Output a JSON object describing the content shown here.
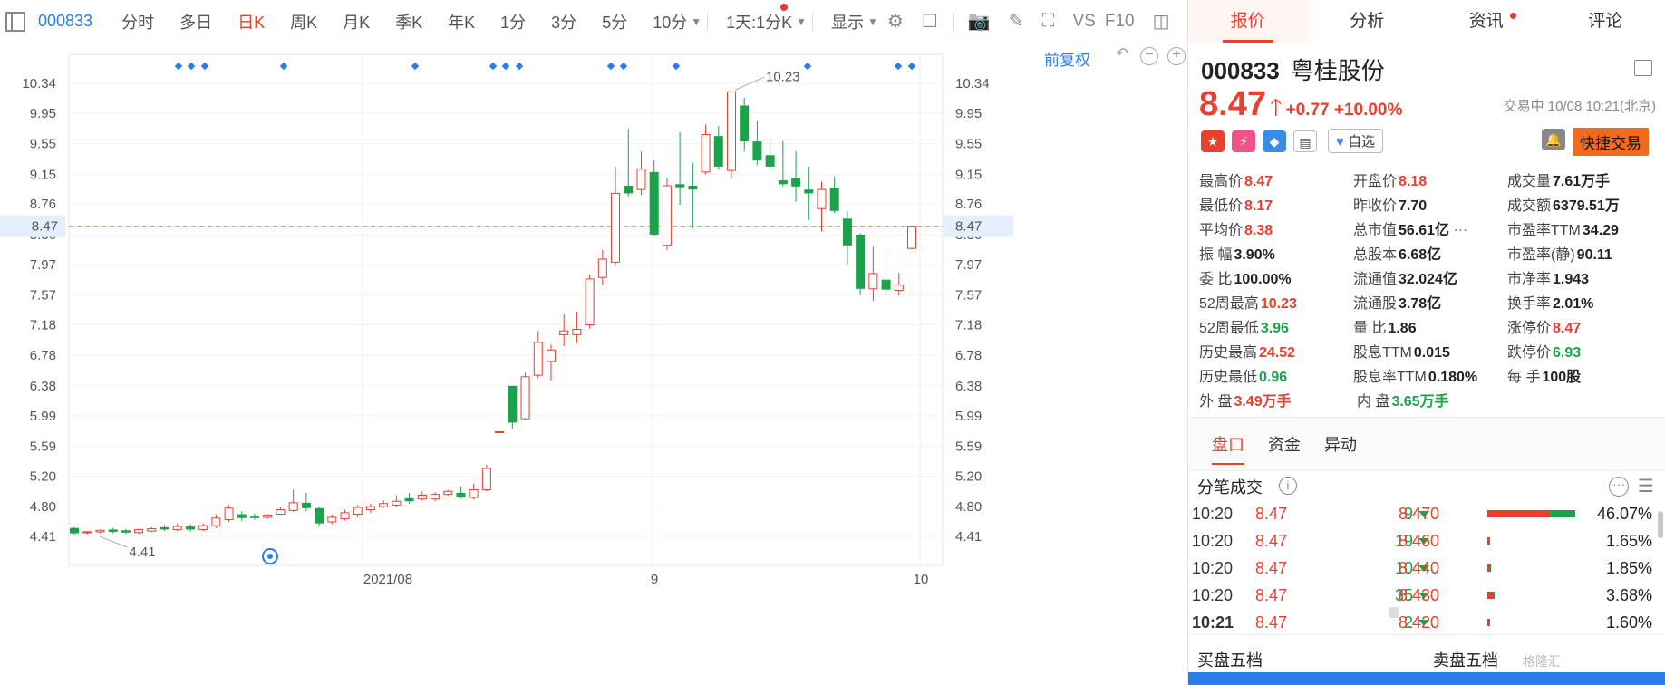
{
  "toolbar": {
    "code": "000833",
    "periods": [
      "分时",
      "多日",
      "日K",
      "周K",
      "月K",
      "季K",
      "年K",
      "1分",
      "3分",
      "5分",
      "10分"
    ],
    "active_period": "日K",
    "range_select": "1天:1分K",
    "display_label": "显示",
    "vs_label": "VS",
    "f10_label": "F10"
  },
  "chart_header": {
    "fuquan": "前复权"
  },
  "chart_data": {
    "type": "candlestick",
    "y_ticks": [
      "10.34",
      "9.95",
      "9.55",
      "9.15",
      "8.76",
      "8.36",
      "7.97",
      "7.57",
      "7.18",
      "6.78",
      "6.38",
      "5.99",
      "5.59",
      "5.20",
      "4.80",
      "4.41"
    ],
    "ylim": [
      4.41,
      10.34
    ],
    "x_labels": [
      "2021/08",
      "9",
      "10"
    ],
    "current_price_label": "8.47",
    "high_annotation": "10.23",
    "low_annotation": "4.41",
    "up_color": "#e8402f",
    "down_color": "#1aa34a",
    "candles": [
      {
        "o": 4.52,
        "c": 4.45,
        "h": 4.53,
        "l": 4.43
      },
      {
        "o": 4.46,
        "c": 4.47,
        "h": 4.48,
        "l": 4.43
      },
      {
        "o": 4.47,
        "c": 4.49,
        "h": 4.5,
        "l": 4.45
      },
      {
        "o": 4.5,
        "c": 4.47,
        "h": 4.52,
        "l": 4.45
      },
      {
        "o": 4.49,
        "c": 4.46,
        "h": 4.51,
        "l": 4.44
      },
      {
        "o": 4.46,
        "c": 4.5,
        "h": 4.51,
        "l": 4.44
      },
      {
        "o": 4.48,
        "c": 4.51,
        "h": 4.53,
        "l": 4.47
      },
      {
        "o": 4.53,
        "c": 4.5,
        "h": 4.56,
        "l": 4.48
      },
      {
        "o": 4.5,
        "c": 4.54,
        "h": 4.58,
        "l": 4.48
      },
      {
        "o": 4.54,
        "c": 4.5,
        "h": 4.57,
        "l": 4.47
      },
      {
        "o": 4.5,
        "c": 4.55,
        "h": 4.58,
        "l": 4.48
      },
      {
        "o": 4.55,
        "c": 4.65,
        "h": 4.7,
        "l": 4.52
      },
      {
        "o": 4.63,
        "c": 4.78,
        "h": 4.82,
        "l": 4.6
      },
      {
        "o": 4.7,
        "c": 4.65,
        "h": 4.74,
        "l": 4.61
      },
      {
        "o": 4.67,
        "c": 4.65,
        "h": 4.71,
        "l": 4.63
      },
      {
        "o": 4.66,
        "c": 4.69,
        "h": 4.7,
        "l": 4.64
      },
      {
        "o": 4.7,
        "c": 4.76,
        "h": 4.79,
        "l": 4.69
      },
      {
        "o": 4.75,
        "c": 4.85,
        "h": 5.02,
        "l": 4.73
      },
      {
        "o": 4.85,
        "c": 4.78,
        "h": 4.98,
        "l": 4.74
      },
      {
        "o": 4.78,
        "c": 4.58,
        "h": 4.8,
        "l": 4.55
      },
      {
        "o": 4.6,
        "c": 4.66,
        "h": 4.7,
        "l": 4.57
      },
      {
        "o": 4.64,
        "c": 4.72,
        "h": 4.76,
        "l": 4.62
      },
      {
        "o": 4.7,
        "c": 4.79,
        "h": 4.82,
        "l": 4.66
      },
      {
        "o": 4.76,
        "c": 4.8,
        "h": 4.84,
        "l": 4.72
      },
      {
        "o": 4.8,
        "c": 4.84,
        "h": 4.88,
        "l": 4.78
      },
      {
        "o": 4.82,
        "c": 4.87,
        "h": 4.95,
        "l": 4.8
      },
      {
        "o": 4.91,
        "c": 4.87,
        "h": 4.98,
        "l": 4.84
      },
      {
        "o": 4.9,
        "c": 4.95,
        "h": 5.0,
        "l": 4.88
      },
      {
        "o": 4.9,
        "c": 4.96,
        "h": 4.99,
        "l": 4.87
      },
      {
        "o": 4.96,
        "c": 5.0,
        "h": 5.02,
        "l": 4.94
      },
      {
        "o": 4.98,
        "c": 4.92,
        "h": 5.06,
        "l": 4.9
      },
      {
        "o": 4.92,
        "c": 5.02,
        "h": 5.1,
        "l": 4.89
      },
      {
        "o": 5.02,
        "c": 5.3,
        "h": 5.35,
        "l": 5.0
      },
      {
        "o": 5.78,
        "c": 5.78,
        "h": 5.78,
        "l": 5.78
      },
      {
        "o": 6.38,
        "c": 5.9,
        "h": 6.38,
        "l": 5.82
      },
      {
        "o": 5.95,
        "c": 6.5,
        "h": 6.55,
        "l": 5.93
      },
      {
        "o": 6.52,
        "c": 6.95,
        "h": 7.1,
        "l": 6.48
      },
      {
        "o": 6.7,
        "c": 6.85,
        "h": 6.92,
        "l": 6.45
      },
      {
        "o": 7.05,
        "c": 7.1,
        "h": 7.32,
        "l": 6.9
      },
      {
        "o": 7.05,
        "c": 7.12,
        "h": 7.35,
        "l": 6.94
      },
      {
        "o": 7.18,
        "c": 7.78,
        "h": 7.83,
        "l": 7.13
      },
      {
        "o": 7.8,
        "c": 8.04,
        "h": 8.16,
        "l": 7.7
      },
      {
        "o": 8.0,
        "c": 8.9,
        "h": 9.25,
        "l": 7.95
      },
      {
        "o": 9.0,
        "c": 8.9,
        "h": 9.75,
        "l": 8.86
      },
      {
        "o": 8.95,
        "c": 9.22,
        "h": 9.45,
        "l": 8.88
      },
      {
        "o": 9.18,
        "c": 8.36,
        "h": 9.33,
        "l": 8.34
      },
      {
        "o": 8.22,
        "c": 9.0,
        "h": 9.1,
        "l": 8.16
      },
      {
        "o": 9.02,
        "c": 8.98,
        "h": 9.7,
        "l": 8.75
      },
      {
        "o": 9.0,
        "c": 8.95,
        "h": 9.3,
        "l": 8.44
      },
      {
        "o": 9.18,
        "c": 9.67,
        "h": 9.8,
        "l": 9.15
      },
      {
        "o": 9.65,
        "c": 9.25,
        "h": 9.78,
        "l": 9.21
      },
      {
        "o": 9.2,
        "c": 10.23,
        "h": 10.23,
        "l": 9.1
      },
      {
        "o": 10.05,
        "c": 9.58,
        "h": 10.15,
        "l": 9.45
      },
      {
        "o": 9.58,
        "c": 9.33,
        "h": 9.85,
        "l": 9.27
      },
      {
        "o": 9.4,
        "c": 9.25,
        "h": 9.62,
        "l": 9.2
      },
      {
        "o": 9.07,
        "c": 9.02,
        "h": 9.59,
        "l": 8.99
      },
      {
        "o": 9.1,
        "c": 8.99,
        "h": 9.45,
        "l": 8.79
      },
      {
        "o": 8.95,
        "c": 8.9,
        "h": 9.25,
        "l": 8.55
      },
      {
        "o": 8.7,
        "c": 8.95,
        "h": 9.05,
        "l": 8.4
      },
      {
        "o": 8.97,
        "c": 8.67,
        "h": 9.12,
        "l": 8.64
      },
      {
        "o": 8.57,
        "c": 8.22,
        "h": 8.67,
        "l": 7.97
      },
      {
        "o": 8.36,
        "c": 7.65,
        "h": 8.38,
        "l": 7.57
      },
      {
        "o": 7.65,
        "c": 7.85,
        "h": 8.2,
        "l": 7.49
      },
      {
        "o": 7.77,
        "c": 7.64,
        "h": 8.18,
        "l": 7.6
      },
      {
        "o": 7.63,
        "c": 7.7,
        "h": 7.86,
        "l": 7.56
      },
      {
        "o": 8.18,
        "c": 8.47,
        "h": 8.47,
        "l": 8.17
      }
    ]
  },
  "tabs": [
    "报价",
    "分析",
    "资讯",
    "评论"
  ],
  "stock": {
    "code": "000833",
    "name": "粤桂股份",
    "price": "8.47",
    "change": "+0.77",
    "change_pct": "+10.00%",
    "status": "交易中 10/08 10:21(北京)",
    "watchlist_label": "自选",
    "quick_trade_label": "快捷交易"
  },
  "stats": [
    [
      {
        "l": "最高价",
        "v": "8.47",
        "c": "red"
      },
      {
        "l": "开盘价",
        "v": "8.18",
        "c": "red"
      },
      {
        "l": "成交量",
        "v": "7.61万手",
        "c": "blk"
      }
    ],
    [
      {
        "l": "最低价",
        "v": "8.17",
        "c": "red"
      },
      {
        "l": "昨收价",
        "v": "7.70",
        "c": "blk"
      },
      {
        "l": "成交额",
        "v": "6379.51万",
        "c": "blk"
      }
    ],
    [
      {
        "l": "平均价",
        "v": "8.38",
        "c": "red"
      },
      {
        "l": "总市值",
        "v": "56.61亿",
        "c": "blk"
      },
      {
        "l": "市盈率TTM",
        "v": "34.29",
        "c": "blk"
      }
    ],
    [
      {
        "l": "振 幅",
        "v": "3.90%",
        "c": "blk"
      },
      {
        "l": "总股本",
        "v": "6.68亿",
        "c": "blk"
      },
      {
        "l": "市盈率(静)",
        "v": "90.11",
        "c": "blk"
      }
    ],
    [
      {
        "l": "委 比",
        "v": "100.00%",
        "c": "blk"
      },
      {
        "l": "流通值",
        "v": "32.024亿",
        "c": "blk"
      },
      {
        "l": "市净率",
        "v": "1.943",
        "c": "blk"
      }
    ],
    [
      {
        "l": "52周最高",
        "v": "10.23",
        "c": "red"
      },
      {
        "l": "流通股",
        "v": "3.78亿",
        "c": "blk"
      },
      {
        "l": "换手率",
        "v": "2.01%",
        "c": "blk"
      }
    ],
    [
      {
        "l": "52周最低",
        "v": "3.96",
        "c": "grn"
      },
      {
        "l": "量 比",
        "v": "1.86",
        "c": "blk"
      },
      {
        "l": "涨停价",
        "v": "8.47",
        "c": "red"
      }
    ],
    [
      {
        "l": "历史最高",
        "v": "24.52",
        "c": "red"
      },
      {
        "l": "股息TTM",
        "v": "0.015",
        "c": "blk"
      },
      {
        "l": "跌停价",
        "v": "6.93",
        "c": "grn"
      }
    ],
    [
      {
        "l": "历史最低",
        "v": "0.96",
        "c": "grn"
      },
      {
        "l": "股息率TTM",
        "v": "0.180%",
        "c": "blk"
      },
      {
        "l": "每 手",
        "v": "100股",
        "c": "blk"
      }
    ],
    [
      {
        "l": "外 盘",
        "v": "3.49万手",
        "c": "red"
      },
      {
        "l": "内 盘",
        "v": "3.65万手",
        "c": "grn"
      }
    ]
  ],
  "subtabs": [
    "盘口",
    "资金",
    "异动"
  ],
  "tick_title": "分笔成交",
  "ticks": [
    {
      "time": "10:20",
      "price": "8.47",
      "vol": "9",
      "dprice": "8.470",
      "dpct": "46.07%",
      "frac": 0.4607
    },
    {
      "time": "10:20",
      "price": "8.47",
      "vol": "19",
      "dprice": "8.460",
      "dpct": "1.65%",
      "frac": 0.0165
    },
    {
      "time": "10:20",
      "price": "8.47",
      "vol": "10",
      "dprice": "8.440",
      "dpct": "1.85%",
      "frac": 0.0185
    },
    {
      "time": "10:20",
      "price": "8.47",
      "vol": "35",
      "dprice": "8.430",
      "dpct": "3.68%",
      "frac": 0.0368
    },
    {
      "time": "10:21",
      "price": "8.47",
      "vol": "2",
      "dprice": "8.420",
      "dpct": "1.60%",
      "frac": 0.016
    }
  ],
  "book": {
    "buy": "买盘五档",
    "sell": "卖盘五档"
  },
  "watermark": "格隆汇"
}
